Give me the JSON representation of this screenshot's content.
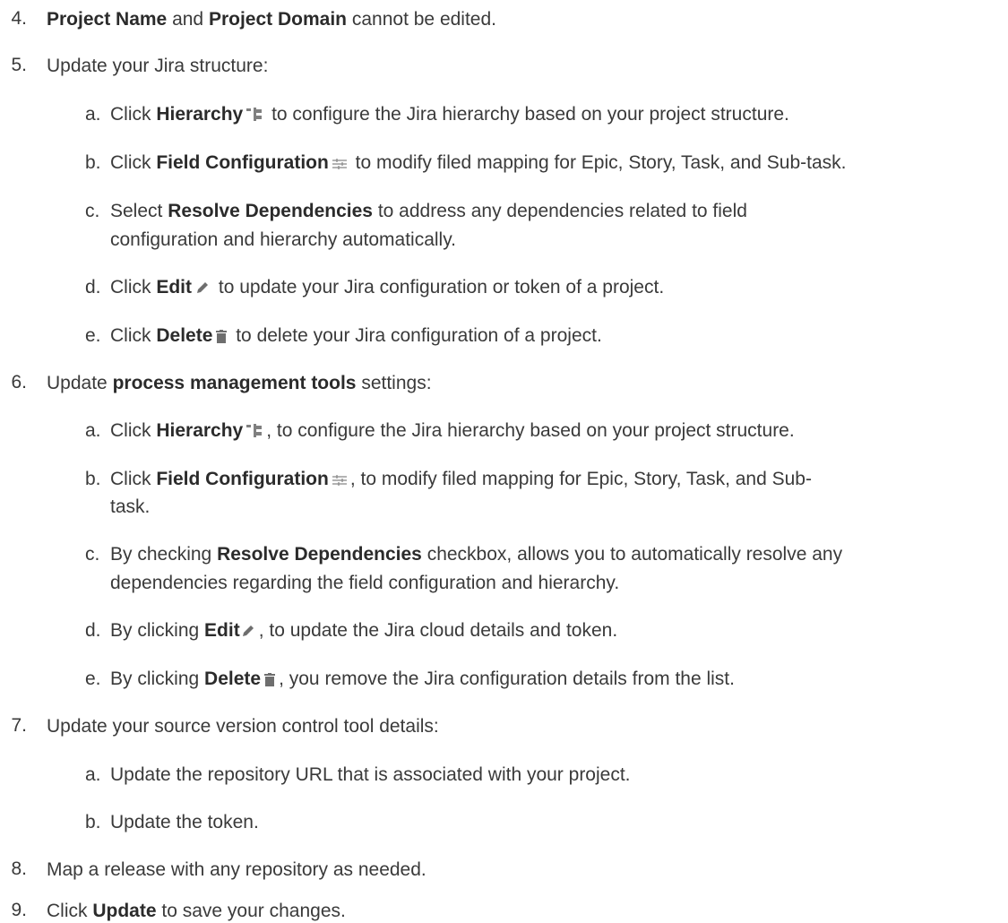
{
  "steps": {
    "s4": {
      "num": "4.",
      "bold1": "Project Name",
      "mid": "and",
      "bold2": "Project Domain",
      "rest": "cannot be edited."
    },
    "s5": {
      "num": "5.",
      "text": "Update your Jira structure:",
      "a": {
        "label": "a.",
        "pre": "Click",
        "bold": "Hierarchy",
        "post": "to configure the Jira hierarchy based on your project structure."
      },
      "b": {
        "label": "b.",
        "pre": "Click",
        "bold": "Field Configuration",
        "post": "to modify filed mapping for Epic, Story, Task, and Sub-task."
      },
      "c": {
        "label": "c.",
        "pre": "Select",
        "bold": "Resolve Dependencies",
        "post": "to address any dependencies related to field",
        "line2": "configuration and hierarchy automatically."
      },
      "d": {
        "label": "d.",
        "pre": "Click",
        "bold": "Edit",
        "post": "to update your Jira configuration or token of a project."
      },
      "e": {
        "label": "e.",
        "pre": "Click",
        "bold": "Delete",
        "post": "to delete your Jira configuration of a project."
      }
    },
    "s6": {
      "num": "6.",
      "pre": "Update",
      "bold": "process management tools",
      "post": "settings:",
      "a": {
        "label": "a.",
        "pre": "Click",
        "bold": "Hierarchy",
        "post": ", to configure the Jira hierarchy based on your project structure."
      },
      "b": {
        "label": "b.",
        "pre": "Click",
        "bold": "Field Configuration",
        "post": ", to modify filed mapping for Epic, Story, Task, and Sub-",
        "line2": "task."
      },
      "c": {
        "label": "c.",
        "pre": "By checking",
        "bold": "Resolve Dependencies",
        "post": "checkbox, allows you to automatically resolve any",
        "line2": "dependencies regarding the field configuration and hierarchy."
      },
      "d": {
        "label": "d.",
        "pre": "By clicking",
        "bold": "Edit",
        "post": ", to update the Jira cloud details and token."
      },
      "e": {
        "label": "e.",
        "pre": "By clicking",
        "bold": "Delete",
        "post": ", you remove the Jira configuration details from the list."
      }
    },
    "s7": {
      "num": "7.",
      "text": "Update your source version control tool details:",
      "a": {
        "label": "a.",
        "text": "Update the repository URL that is associated with your project."
      },
      "b": {
        "label": "b.",
        "text": "Update the token."
      }
    },
    "s8": {
      "num": "8.",
      "text": "Map a release with any repository as needed."
    },
    "s9": {
      "num": "9.",
      "pre": "Click",
      "bold": "Update",
      "post": "to save your changes."
    }
  },
  "icons": {
    "hierarchy": "hierarchy-icon",
    "field_config": "field-configuration-icon",
    "edit": "pencil-icon",
    "delete": "trash-icon"
  }
}
